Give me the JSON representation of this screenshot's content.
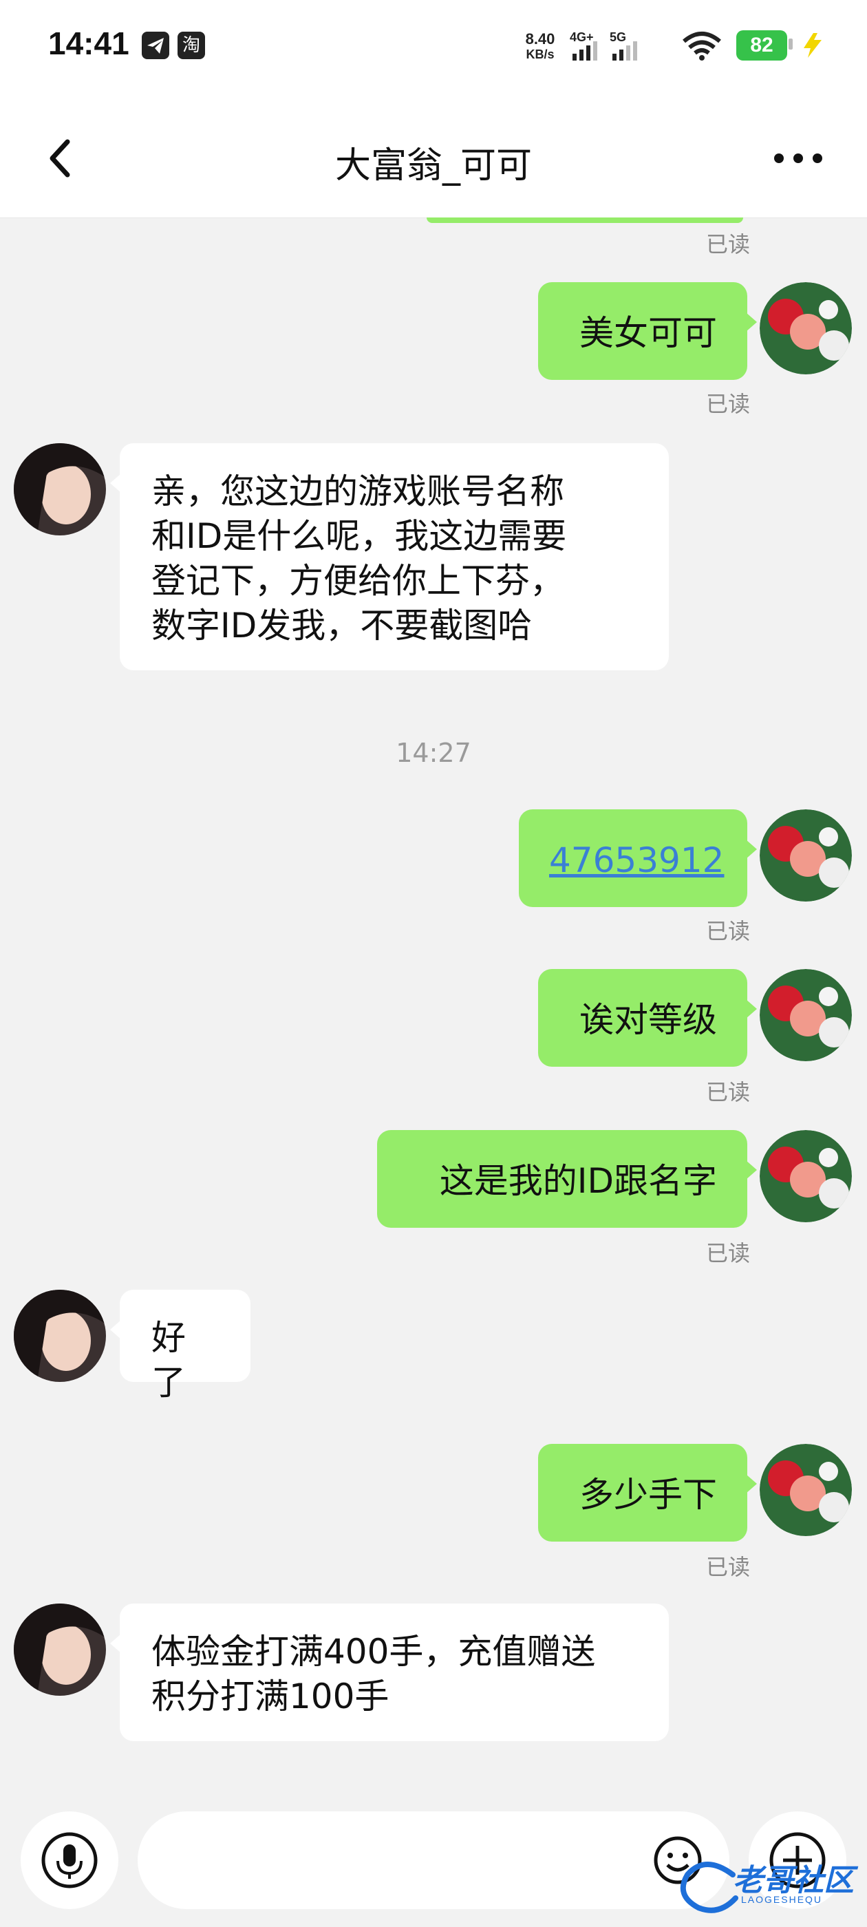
{
  "status_bar": {
    "time": "14:41",
    "app_icons": [
      "telegram-icon",
      "taobao-icon"
    ],
    "taobao_glyph": "淘",
    "net_speed_value": "8.40",
    "net_speed_unit": "KB/s",
    "signal_1_label": "4G+",
    "signal_2_label": "5G",
    "battery_level": "82",
    "charging": true
  },
  "header": {
    "title": "大富翁_可可"
  },
  "messages": [
    {
      "side": "right",
      "text": "美女可可",
      "status": "已读"
    },
    {
      "side": "left",
      "lines": [
        "亲，您这边的游戏账号名称",
        "和ID是什么呢，我这边需要",
        "登记下，方便给你上下芬，",
        "数字ID发我，不要截图哈"
      ]
    },
    {
      "type": "time",
      "text": "14:27"
    },
    {
      "side": "right",
      "text": "47653912",
      "is_link": true,
      "status": "已读"
    },
    {
      "side": "right",
      "text": "诶对等级",
      "status": "已读"
    },
    {
      "side": "right",
      "text": "这是我的ID跟名字",
      "status": "已读"
    },
    {
      "side": "left",
      "text": "好了"
    },
    {
      "side": "right",
      "text": "多少手下",
      "status": "已读"
    },
    {
      "side": "left",
      "lines": [
        "体验金打满400手，充值赠送",
        "积分打满100手"
      ]
    }
  ],
  "top_partial_status": "已读",
  "input_bar": {
    "placeholder": "",
    "value": ""
  },
  "watermark": {
    "text": "老哥社区",
    "sub": "LAOGESHEQU"
  },
  "colors": {
    "bubble_right": "#95ec69",
    "bubble_left": "#ffffff",
    "background": "#f2f2f2",
    "link": "#3a7fd5",
    "battery": "#36c24a"
  }
}
